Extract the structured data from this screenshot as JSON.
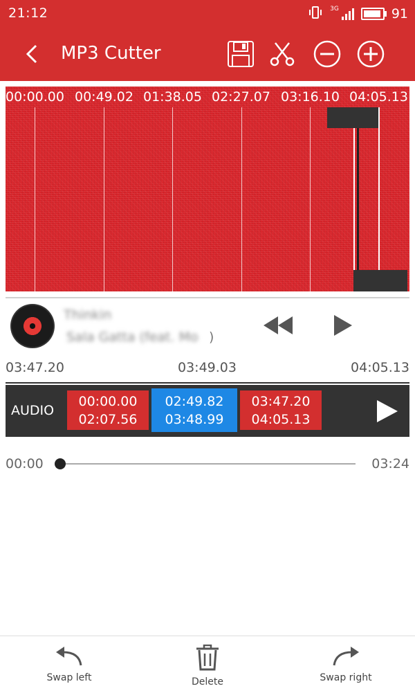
{
  "status_bar": {
    "time": "21:12",
    "network": "3G",
    "battery_level": "91"
  },
  "app_bar": {
    "title": "MP3 Cutter",
    "icons": [
      "back-arrow-icon",
      "save-icon",
      "scissors-icon",
      "zoom-out-icon",
      "zoom-in-icon"
    ]
  },
  "waveform": {
    "ticks": [
      "00:00.00",
      "00:49.02",
      "01:38.05",
      "02:27.07",
      "03:16.10",
      "04:05.13"
    ],
    "color": "#d7242a"
  },
  "track": {
    "title": "Thinkin",
    "artist": "Sala Gatta (feat. Mo",
    "artist_suffix": ")"
  },
  "selection_times": {
    "start": "03:47.20",
    "middle": "03:49.03",
    "end": "04:05.13"
  },
  "audio_bar": {
    "label": "AUDIO",
    "segments": [
      {
        "start": "00:00.00",
        "end": "02:07.56",
        "color": "#d32f2f"
      },
      {
        "start": "02:49.82",
        "end": "03:48.99",
        "color": "#1e88e5"
      },
      {
        "start": "03:47.20",
        "end": "04:05.13",
        "color": "#d32f2f"
      }
    ]
  },
  "playback": {
    "current": "00:00",
    "total": "03:24",
    "progress": 0
  },
  "bottom_bar": {
    "swap_left": "Swap left",
    "delete": "Delete",
    "swap_right": "Swap right"
  },
  "colors": {
    "accent": "#d32f2f",
    "selected_segment": "#1e88e5",
    "dark_bar": "#333333"
  }
}
